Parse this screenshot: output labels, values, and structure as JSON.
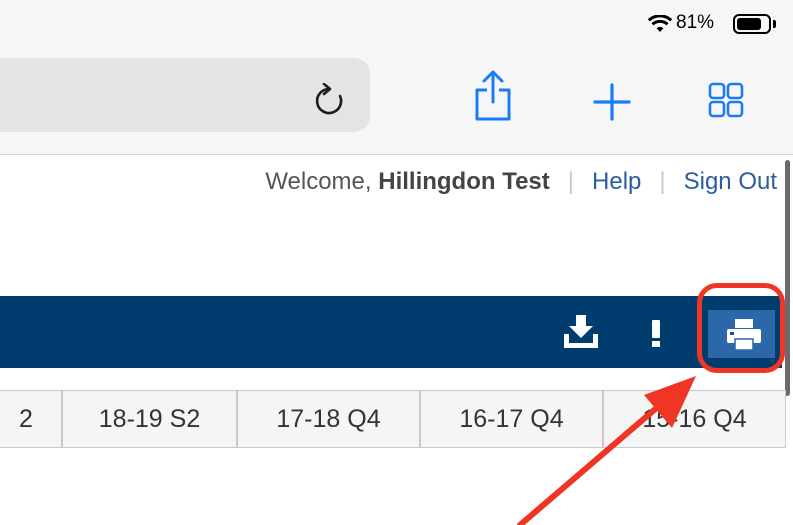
{
  "status_bar": {
    "battery_percent": "81%",
    "battery_level": 0.81,
    "icons": [
      "wifi-icon",
      "battery-icon"
    ]
  },
  "toolbar": {
    "icons": [
      "reload-icon",
      "share-icon",
      "new-tab-icon",
      "tabs-overview-icon"
    ]
  },
  "header": {
    "welcome_prefix": "Welcome, ",
    "user_name": "Hillingdon Test",
    "separator": "|",
    "help_label": "Help",
    "signout_label": "Sign Out"
  },
  "actionbar": {
    "icons": [
      "download-icon",
      "exclamation-icon",
      "print-icon"
    ]
  },
  "tabs": [
    "2",
    "18-19 S2",
    "17-18 Q4",
    "16-17 Q4",
    "15-16 Q4"
  ],
  "annotation": {
    "color": "#ef3524",
    "shapes": [
      "highlight-box",
      "arrow"
    ]
  },
  "colors": {
    "bar": "#003d6e",
    "link": "#2b5e9d",
    "safari_blue": "#1a7cf5",
    "print_bg": "#2c67a9"
  }
}
